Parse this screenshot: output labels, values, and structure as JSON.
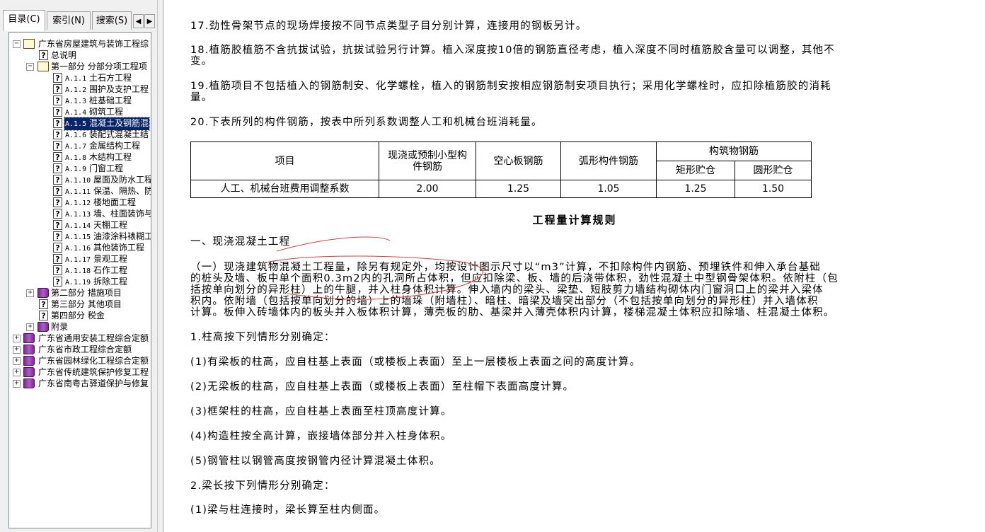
{
  "tabs": [
    {
      "label": "目录(C)"
    },
    {
      "label": "索引(N)"
    },
    {
      "label": "搜索(S)"
    }
  ],
  "tab_prev_glyph": "◀",
  "tab_next_glyph": "▶",
  "tree": {
    "root": "广东省房屋建筑与装饰工程综",
    "overview": "总说明",
    "part1": "第一部分 分部分项工程项",
    "items": [
      {
        "code": "A.1.1",
        "name": "土石方工程"
      },
      {
        "code": "A.1.2",
        "name": "围护及支护工程"
      },
      {
        "code": "A.1.3",
        "name": "桩基础工程"
      },
      {
        "code": "A.1.4",
        "name": "砌筑工程"
      },
      {
        "code": "A.1.5",
        "name": "混凝土及钢筋混"
      },
      {
        "code": "A.1.6",
        "name": "装配式混凝土结"
      },
      {
        "code": "A.1.7",
        "name": "金属结构工程"
      },
      {
        "code": "A.1.8",
        "name": "木结构工程"
      },
      {
        "code": "A.1.9",
        "name": "门窗工程"
      },
      {
        "code": "A.1.10",
        "name": "屋面及防水工程"
      },
      {
        "code": "A.1.11",
        "name": "保温、隔热、防"
      },
      {
        "code": "A.1.12",
        "name": "楼地面工程"
      },
      {
        "code": "A.1.13",
        "name": "墙、柱面装饰与"
      },
      {
        "code": "A.1.14",
        "name": "天棚工程"
      },
      {
        "code": "A.1.15",
        "name": "油漆涂料裱糊工"
      },
      {
        "code": "A.1.16",
        "name": "其他装饰工程"
      },
      {
        "code": "A.1.17",
        "name": "景观工程"
      },
      {
        "code": "A.1.18",
        "name": "石作工程"
      },
      {
        "code": "A.1.19",
        "name": "拆除工程"
      }
    ],
    "part2": "第二部分 措施项目",
    "part3": "第三部分 其他项目",
    "part4": "第四部分 税金",
    "appendix": "附录",
    "others": [
      "广东省通用安装工程综合定额",
      "广东省市政工程综合定额",
      "广东省园林绿化工程综合定额",
      "广东省传统建筑保护修复工程",
      "广东省南粤古驿道保护与修复"
    ],
    "selected_index": 4
  },
  "content": {
    "p17": "17.劲性骨架节点的现场焊接按不同节点类型子目分别计算，连接用的钢板另计。",
    "p18a": "18.植筋胶植筋不含抗拔试验，抗拔试验另行计算。植入深度按10倍的钢筋直径考虑，植入深度不同时植筋胶含量可以调整，其他不",
    "p18b": "变。",
    "p19a": "19.植筋项目不包括植入的钢筋制安、化学螺栓，植入的钢筋制安按相应钢筋制安项目执行；采用化学螺栓时，应扣除植筋胶的消耗",
    "p19b": "量。",
    "p20": "20.下表所列的构件钢筋，按表中所列系数调整人工和机械台班消耗量。",
    "table": {
      "h_item": "项目",
      "h_small_a": "现浇或预制小型构",
      "h_small_b": "件钢筋",
      "h_hollow": "空心板钢筋",
      "h_arc": "弧形构件钢筋",
      "h_struct": "构筑物钢筋",
      "h_rect": "矩形贮仓",
      "h_round": "圆形贮仓",
      "row_label": "人工、机械台班费用调整系数",
      "values": [
        "2.00",
        "1.25",
        "1.05",
        "1.25",
        "1.50"
      ]
    },
    "section_title": "工程量计算规则",
    "sub1": "一、现浇混凝土工程",
    "para1_l1": "（一）现浇建筑物混凝土工程量，除另有规定外，均按设计图示尺寸以“m3”计算，不扣除构件内钢筋、预埋铁件和伸入承台基础",
    "para1_l2": "的桩头及墙、板中单个面积0.3m2内的孔洞所占体积，但应扣除梁、板、墙的后浇带体积，劲性混凝土中型钢骨架体积。依附柱（包",
    "para1_l3": "括按单向划分的异形柱）上的牛腿，并入柱身体积计算。伸入墙内的梁头、梁垫、短肢剪力墙结构砌体内门窗洞口上的梁并入梁体",
    "para1_l4": "积内。依附墙（包括按单向划分的墙）上的墙垛（附墙柱）、暗柱、暗梁及墙突出部分（不包括按单向划分的异形柱）并入墙体积",
    "para1_l5": "计算。板伸入砖墙体内的板头并入板体积计算，薄壳板的肋、基梁并入薄壳体积内计算，楼梯混凝土体积应扣除墙、柱混凝土体积。",
    "c1": "1.柱高按下列情形分别确定：",
    "c1_1": "(1)有梁板的柱高，应自柱基上表面（或楼板上表面）至上一层楼板上表面之间的高度计算。",
    "c1_2": "(2)无梁板的柱高，应自柱基上表面（或楼板上表面）至柱帽下表面高度计算。",
    "c1_3": "(3)框架柱的柱高，应自柱基上表面至柱顶高度计算。",
    "c1_4": "(4)构造柱按全高计算，嵌接墙体部分并入柱身体积。",
    "c1_5": "(5)钢管柱以钢管高度按钢管内径计算混凝土体积。",
    "c2": "2.梁长按下列情形分别确定：",
    "c2_1": "(1)梁与柱连接时，梁长算至柱内侧面。"
  },
  "colors": {
    "selection": "#0a246a",
    "annotation": "#d04040"
  }
}
